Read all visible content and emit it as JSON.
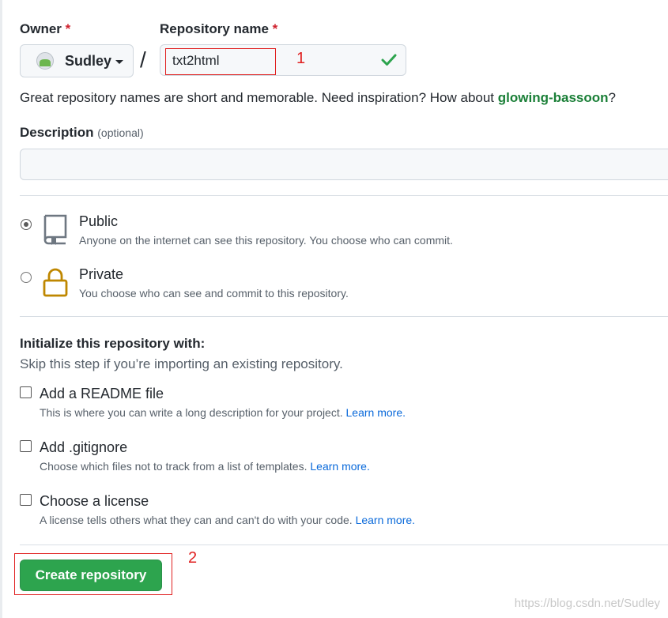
{
  "owner": {
    "label": "Owner",
    "required_mark": "*",
    "value": "Sudley"
  },
  "repo_name": {
    "label": "Repository name",
    "required_mark": "*",
    "value": "txt2html",
    "status_icon": "check-icon"
  },
  "separator": "/",
  "annotations": {
    "step1": "1",
    "step2": "2"
  },
  "hint": {
    "prefix": "Great repository names are short and memorable. Need inspiration? How about",
    "suggestion": "glowing-bassoon",
    "suffix": "?"
  },
  "description": {
    "label": "Description",
    "optional": "(optional)",
    "value": ""
  },
  "visibility": [
    {
      "title": "Public",
      "desc": "Anyone on the internet can see this repository. You choose who can commit.",
      "selected": true,
      "icon": "repo-book-icon"
    },
    {
      "title": "Private",
      "desc": "You choose who can see and commit to this repository.",
      "selected": false,
      "icon": "lock-icon"
    }
  ],
  "initialize": {
    "title": "Initialize this repository with:",
    "subtitle": "Skip this step if you’re importing an existing repository.",
    "options": [
      {
        "title": "Add a README file",
        "desc": "This is where you can write a long description for your project.",
        "link": "Learn more.",
        "checked": false
      },
      {
        "title": "Add .gitignore",
        "desc": "Choose which files not to track from a list of templates.",
        "link": "Learn more.",
        "checked": false
      },
      {
        "title": "Choose a license",
        "desc": "A license tells others what they can and can't do with your code.",
        "link": "Learn more.",
        "checked": false
      }
    ]
  },
  "create_button": "Create repository",
  "watermark": "https://blog.csdn.net/Sudley",
  "colors": {
    "primary_button": "#2da44e",
    "link": "#0969da",
    "suggestion": "#1a7f37",
    "required": "#cf222e",
    "annotation": "#e02020"
  }
}
